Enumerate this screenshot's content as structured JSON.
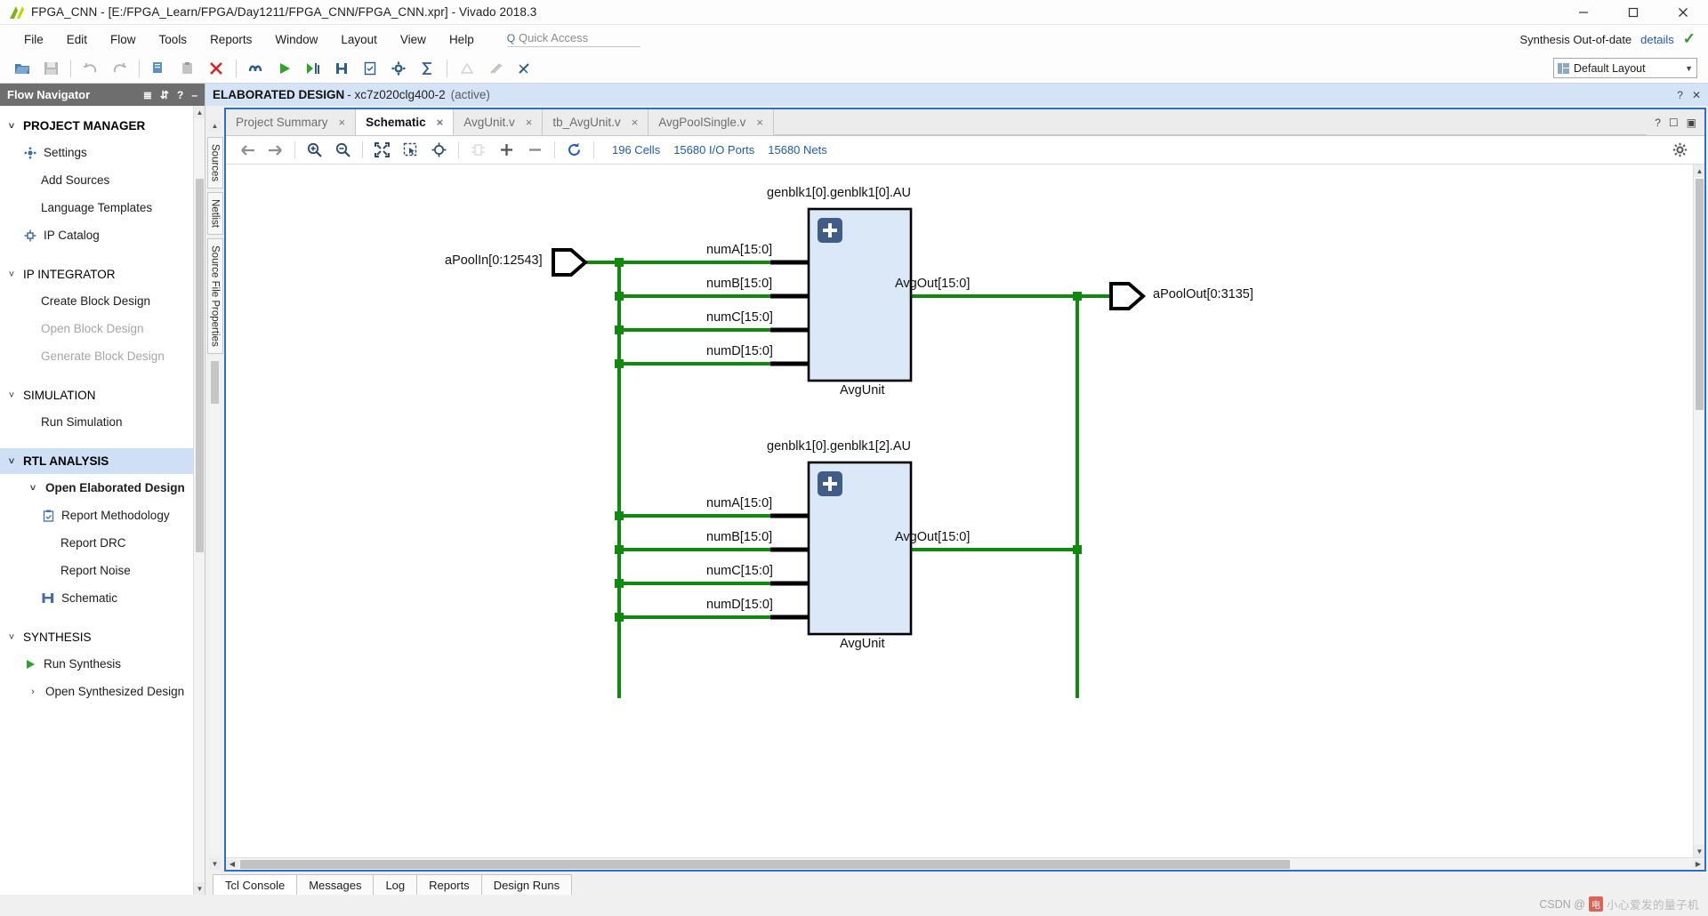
{
  "window": {
    "title": "FPGA_CNN - [E:/FPGA_Learn/FPGA/Day1211/FPGA_CNN/FPGA_CNN.xpr] - Vivado 2018.3",
    "minimize": "—",
    "maximize": "☐",
    "close": "✕"
  },
  "menu": {
    "items": [
      {
        "label": "File"
      },
      {
        "label": "Edit"
      },
      {
        "label": "Flow"
      },
      {
        "label": "Tools"
      },
      {
        "label": "Reports"
      },
      {
        "label": "Window"
      },
      {
        "label": "Layout"
      },
      {
        "label": "View"
      },
      {
        "label": "Help"
      }
    ],
    "quick_access_placeholder": "Quick Access",
    "synth_status": "Synthesis Out-of-date",
    "details_link": "details"
  },
  "toolbar": {
    "layout_label": "Default Layout"
  },
  "flow_navigator": {
    "title": "Flow Navigator",
    "sections": [
      {
        "label": "PROJECT MANAGER",
        "items": [
          {
            "label": "Settings",
            "icon": "gear-icon",
            "disabled": false
          },
          {
            "label": "Add Sources",
            "icon": "",
            "disabled": false
          },
          {
            "label": "Language Templates",
            "icon": "",
            "disabled": false
          },
          {
            "label": "IP Catalog",
            "icon": "ip-icon",
            "disabled": false
          }
        ]
      },
      {
        "label": "IP INTEGRATOR",
        "items": [
          {
            "label": "Create Block Design",
            "icon": "",
            "disabled": false
          },
          {
            "label": "Open Block Design",
            "icon": "",
            "disabled": true
          },
          {
            "label": "Generate Block Design",
            "icon": "",
            "disabled": true
          }
        ]
      },
      {
        "label": "SIMULATION",
        "items": [
          {
            "label": "Run Simulation",
            "icon": "",
            "disabled": false
          }
        ]
      },
      {
        "label": "RTL ANALYSIS",
        "active": true,
        "items": [
          {
            "label": "Open Elaborated Design",
            "icon": "caret",
            "bold": true,
            "disabled": false
          },
          {
            "label": "Report Methodology",
            "icon": "clipboard-icon",
            "indent": true,
            "disabled": false
          },
          {
            "label": "Report DRC",
            "icon": "",
            "indent": true,
            "disabled": false
          },
          {
            "label": "Report Noise",
            "icon": "",
            "indent": true,
            "disabled": false
          },
          {
            "label": "Schematic",
            "icon": "schematic-icon",
            "indent": true,
            "disabled": false
          }
        ]
      },
      {
        "label": "SYNTHESIS",
        "items": [
          {
            "label": "Run Synthesis",
            "icon": "play-icon",
            "disabled": false
          },
          {
            "label": "Open Synthesized Design",
            "icon": "caret",
            "disabled": false
          }
        ]
      }
    ]
  },
  "design_header": {
    "title": "ELABORATED DESIGN",
    "part": "- xc7z020clg400-2",
    "state": "(active)",
    "help": "?",
    "close": "✕"
  },
  "vertical_tabs": [
    "Sources",
    "Netlist",
    "Source File Properties"
  ],
  "editor_tabs": [
    {
      "label": "Project Summary",
      "active": false
    },
    {
      "label": "Schematic",
      "active": true
    },
    {
      "label": "AvgUnit.v",
      "active": false
    },
    {
      "label": "tb_AvgUnit.v",
      "active": false
    },
    {
      "label": "AvgPoolSingle.v",
      "active": false
    }
  ],
  "schematic_toolbar": {
    "stats": [
      "196 Cells",
      "15680 I/O Ports",
      "15680 Nets"
    ],
    "buttons": [
      "back-arrow-icon",
      "forward-arrow-icon",
      "zoom-in-icon",
      "zoom-out-icon",
      "zoom-fit-icon",
      "zoom-area-icon",
      "crosshair-icon",
      "cell-icon",
      "plus-icon",
      "minus-icon",
      "refresh-icon"
    ],
    "settings_icon": "gear-icon"
  },
  "schematic": {
    "input_port": {
      "label": "aPoolIn[0:12543]"
    },
    "output_port": {
      "label": "aPoolOut[0:3135]"
    },
    "blocks": [
      {
        "title": "genblk1[0].genblk1[0].AU",
        "subtitle": "AvgUnit",
        "badge": "+",
        "inputs": [
          "numA[15:0]",
          "numB[15:0]",
          "numC[15:0]",
          "numD[15:0]"
        ],
        "output": "AvgOut[15:0]"
      },
      {
        "title": "genblk1[0].genblk1[2].AU",
        "subtitle": "AvgUnit",
        "badge": "+",
        "inputs": [
          "numA[15:0]",
          "numB[15:0]",
          "numC[15:0]",
          "numD[15:0]"
        ],
        "output": "AvgOut[15:0]"
      }
    ],
    "colors": {
      "net": "#0f8a0f",
      "block_fill": "#dbe8f7",
      "block_stroke": "#000000",
      "badge_fill": "#3f5d87"
    }
  },
  "bottom_tabs": [
    {
      "label": "Tcl Console",
      "active": true
    },
    {
      "label": "Messages",
      "active": false
    },
    {
      "label": "Log",
      "active": false
    },
    {
      "label": "Reports",
      "active": false
    },
    {
      "label": "Design Runs",
      "active": false
    }
  ],
  "watermark": {
    "prefix": "CSDN @",
    "badge": "电",
    "text": "小心爱发的量子机"
  }
}
